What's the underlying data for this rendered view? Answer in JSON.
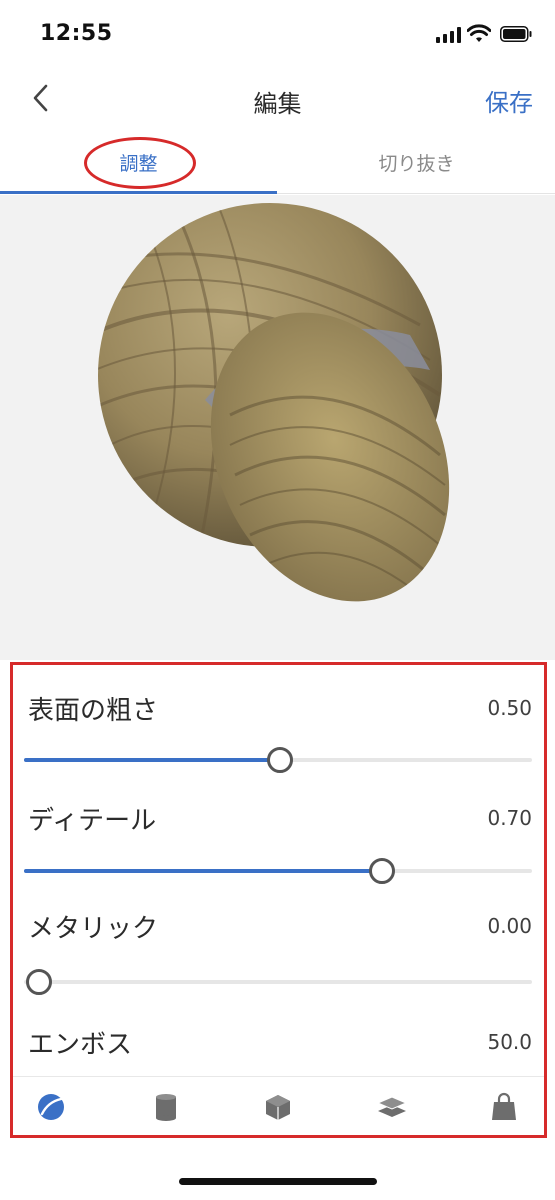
{
  "status": {
    "time": "12:55"
  },
  "nav": {
    "title": "編集",
    "save_label": "保存"
  },
  "tabs": [
    {
      "label": "調整",
      "active": true
    },
    {
      "label": "切り抜き",
      "active": false
    }
  ],
  "sliders": [
    {
      "label": "表面の粗さ",
      "value": "0.50",
      "fraction": 0.5
    },
    {
      "label": "ディテール",
      "value": "0.70",
      "fraction": 0.7
    },
    {
      "label": "メタリック",
      "value": "0.00",
      "fraction": 0.0
    },
    {
      "label": "エンボス",
      "value": "50.0"
    }
  ],
  "toolbar": {
    "items": [
      "material-icon",
      "cylinder-icon",
      "cube-icon",
      "layers-icon",
      "shopping-bag-icon"
    ],
    "active": "material-icon"
  },
  "colors": {
    "accent": "#3a70c6",
    "annotation": "#d62a2a",
    "preview_bg": "#f2f2f2"
  }
}
